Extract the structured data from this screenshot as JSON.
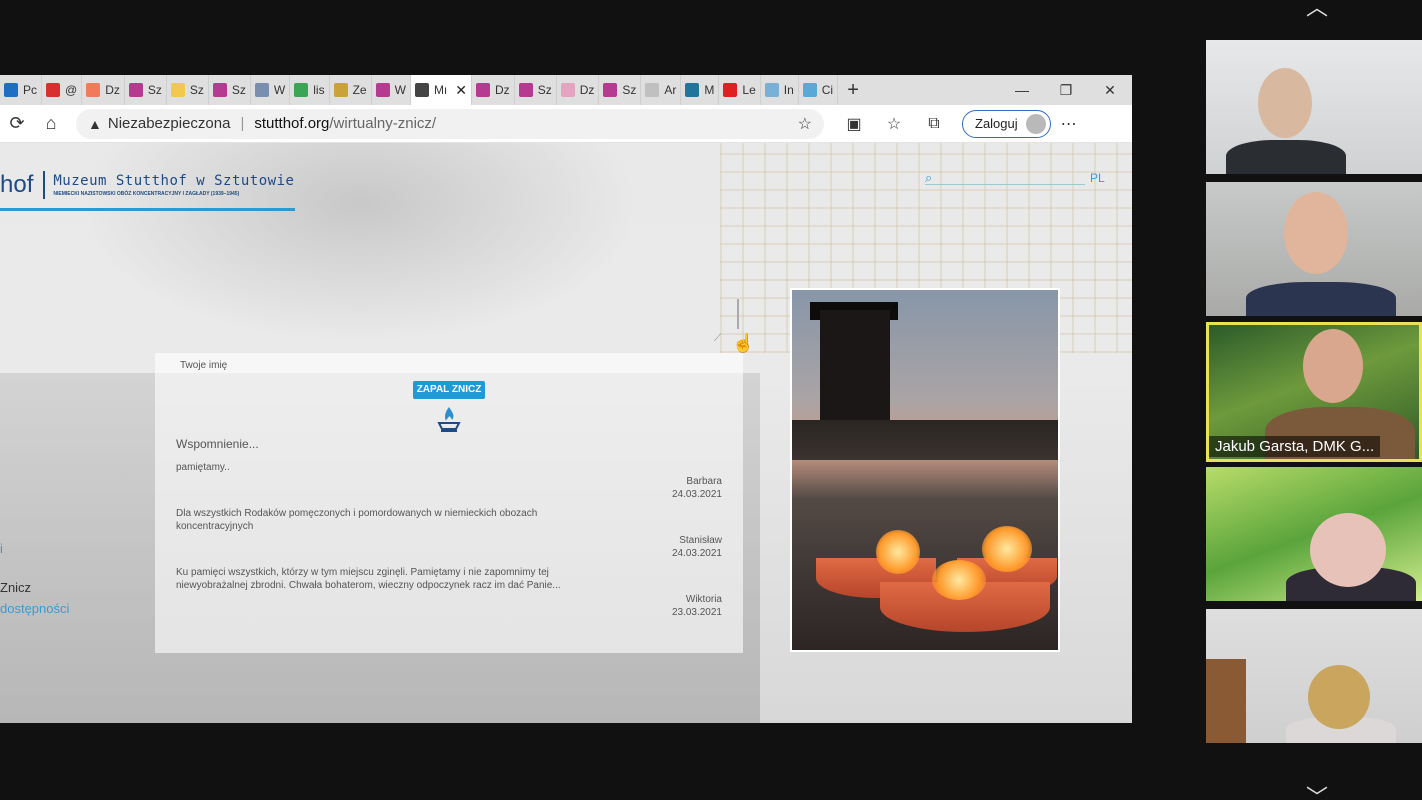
{
  "browser": {
    "tabs": [
      {
        "label": "Pc",
        "color": "#1d6fc4"
      },
      {
        "label": "@",
        "color": "#d8302f"
      },
      {
        "label": "Dz",
        "color": "#f07a5a"
      },
      {
        "label": "Sz",
        "color": "#b63a8f"
      },
      {
        "label": "Sz",
        "color": "#f2c94c"
      },
      {
        "label": "Sz",
        "color": "#b63a8f"
      },
      {
        "label": "W",
        "color": "#7a8fb0"
      },
      {
        "label": "lis",
        "color": "#3aa655"
      },
      {
        "label": "Ze",
        "color": "#c9a23a"
      },
      {
        "label": "W",
        "color": "#b63a8f"
      },
      {
        "label": "Mı",
        "color": "#444444",
        "active": true
      },
      {
        "label": "Dz",
        "color": "#b63a8f"
      },
      {
        "label": "Sz",
        "color": "#b63a8f"
      },
      {
        "label": "Dz",
        "color": "#e4a3c0"
      },
      {
        "label": "Sz",
        "color": "#b63a8f"
      },
      {
        "label": "Ar",
        "color": "#c0c0c0"
      },
      {
        "label": "M",
        "color": "#21759b"
      },
      {
        "label": "Le",
        "color": "#e02020"
      },
      {
        "label": "In",
        "color": "#7ab0d6"
      },
      {
        "label": "Ci",
        "color": "#59a8d6"
      }
    ],
    "address": {
      "insecure_label": "Niezabezpieczona",
      "host": "stutthof.org",
      "path": "/wirtualny-znicz/"
    },
    "login_label": "Zaloguj"
  },
  "page": {
    "logo_short": "hof",
    "logo_title": "Muzeum Stutthof w Sztutowie",
    "logo_subtitle": "NIEMIECKI NAZISTOWSKI OBÓZ KONCENTRACYJNY I ZAGŁADY (1939–1945)",
    "lang": "PL",
    "side_links": [
      "i",
      "Znicz",
      "dostępności"
    ],
    "form": {
      "name_label": "Twoje imię",
      "button_label": "ZAPAL ZNICZ",
      "memory_placeholder": "Wspomnienie..."
    },
    "entries": [
      {
        "text": "pamiętamy..",
        "author": "Barbara",
        "date": "24.03.2021"
      },
      {
        "text": "Dla wszystkich Rodaków pomęczonych i pomordowanych w niemieckich obozach koncentracyjnych",
        "author": "Stanisław",
        "date": "24.03.2021"
      },
      {
        "text": "Ku pamięci wszystkich, którzy w tym miejscu zginęli. Pamiętamy i nie zapomnimy tej niewyobrażalnej zbrodni. Chwała bohaterom, wieczny odpoczynek racz im dać Panie...",
        "author": "Wiktoria",
        "date": "23.03.2021"
      }
    ]
  },
  "gallery": {
    "speaker_name": "Jakub Garsta, DMK G..."
  }
}
